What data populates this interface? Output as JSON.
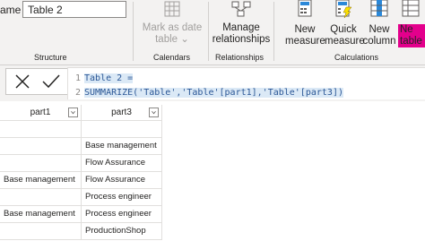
{
  "ribbon": {
    "name_label": "ame",
    "name_value": "Table 2",
    "structure_label": "Structure",
    "mark_as_date": {
      "line1": "Mark as date",
      "line2": "table"
    },
    "calendars_label": "Calendars",
    "manage_relationships": {
      "line1": "Manage",
      "line2": "relationships"
    },
    "relationships_label": "Relationships",
    "new_measure": {
      "line1": "New",
      "line2": "measure"
    },
    "quick_measure": {
      "line1": "Quick",
      "line2": "measure"
    },
    "new_column": {
      "line1": "New",
      "line2": "column"
    },
    "new_table": {
      "line1": "Ne",
      "line2": "table"
    },
    "calculations_label": "Calculations"
  },
  "formula": {
    "line1_no": "1",
    "line1": "Table 2 =",
    "line2_no": "2",
    "line2": "SUMMARIZE('Table','Table'[part1],'Table'[part3])"
  },
  "table": {
    "headers": [
      "part1",
      "part3"
    ],
    "rows": [
      [
        "",
        ""
      ],
      [
        "",
        "Base management"
      ],
      [
        "",
        "Flow Assurance"
      ],
      [
        "Base management",
        "Flow Assurance"
      ],
      [
        "",
        "Process engineer"
      ],
      [
        "Base management",
        "Process engineer"
      ],
      [
        "",
        "ProductionShop"
      ]
    ]
  },
  "colors": {
    "new_table_highlight": "#e3008c",
    "icon_blue": "#2b88d8",
    "icon_yellow": "#fce100",
    "ribbon_bg": "#f3f2f1"
  }
}
